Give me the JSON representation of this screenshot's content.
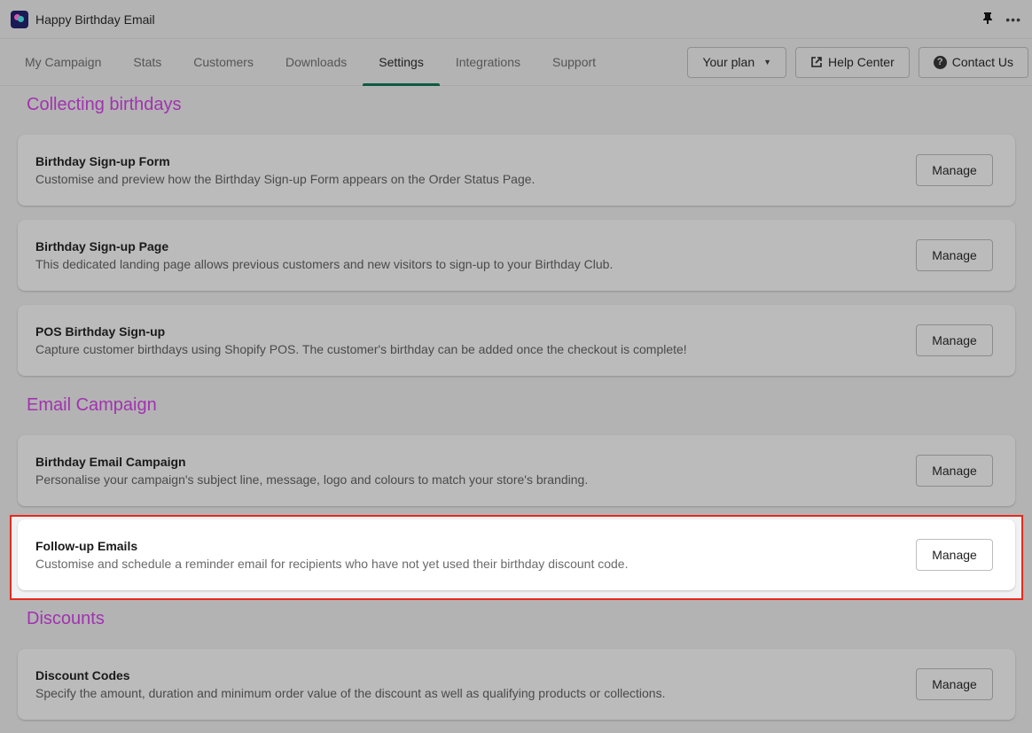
{
  "app": {
    "title": "Happy Birthday Email",
    "logo_icon": "balloons-logo",
    "pin_icon": "pin-icon",
    "more_icon": "more-icon"
  },
  "nav": {
    "tabs": [
      {
        "label": "My Campaign",
        "active": false
      },
      {
        "label": "Stats",
        "active": false
      },
      {
        "label": "Customers",
        "active": false
      },
      {
        "label": "Downloads",
        "active": false
      },
      {
        "label": "Settings",
        "active": true
      },
      {
        "label": "Integrations",
        "active": false
      },
      {
        "label": "Support",
        "active": false
      }
    ],
    "your_plan_label": "Your plan",
    "help_center_label": "Help Center",
    "contact_us_label": "Contact Us"
  },
  "sections": [
    {
      "title": "Collecting birthdays",
      "cards": [
        {
          "title": "Birthday Sign-up Form",
          "description": "Customise and preview how the Birthday Sign-up Form appears on the Order Status Page.",
          "button": "Manage"
        },
        {
          "title": "Birthday Sign-up Page",
          "description": "This dedicated landing page allows previous customers and new visitors to sign-up to your Birthday Club.",
          "button": "Manage"
        },
        {
          "title": "POS Birthday Sign-up",
          "description": "Capture customer birthdays using Shopify POS. The customer's birthday can be added once the checkout is complete!",
          "button": "Manage"
        }
      ]
    },
    {
      "title": "Email Campaign",
      "cards": [
        {
          "title": "Birthday Email Campaign",
          "description": "Personalise your campaign's subject line, message, logo and colours to match your store's branding.",
          "button": "Manage"
        },
        {
          "title": "Follow-up Emails",
          "description": "Customise and schedule a reminder email for recipients who have not yet used their birthday discount code.",
          "button": "Manage",
          "highlighted": true
        }
      ]
    },
    {
      "title": "Discounts",
      "cards": [
        {
          "title": "Discount Codes",
          "description": "Specify the amount, duration and minimum order value of the discount as well as qualifying products or collections.",
          "button": "Manage"
        }
      ]
    }
  ],
  "colors": {
    "section_title": "#a232b0",
    "active_tab_underline": "#0c5b43",
    "highlight_outline": "#e8291c"
  }
}
